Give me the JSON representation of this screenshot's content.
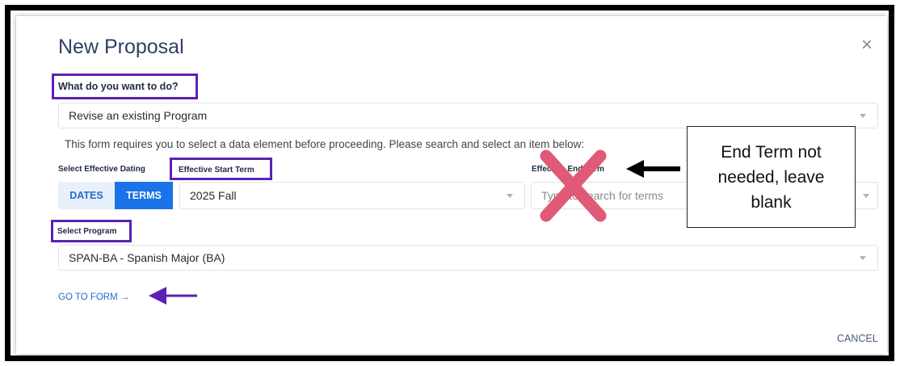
{
  "dialog": {
    "title": "New Proposal",
    "close_glyph": "×"
  },
  "question": {
    "label": "What do you want to do?",
    "value": "Revise an existing Program"
  },
  "info_text": "This form requires you to select a data element before proceeding. Please search and select an item below:",
  "dating": {
    "label": "Select Effective Dating",
    "start_label": "Effective Start Term",
    "dates_button": "DATES",
    "terms_button": "TERMS",
    "start_value": "2025 Fall",
    "end_label": "Effective End Term",
    "end_placeholder": "Type to search for terms"
  },
  "program": {
    "label": "Select Program",
    "value": "SPAN-BA - Spanish Major (BA)"
  },
  "actions": {
    "goto_label": "GO TO FORM",
    "goto_arrow": "→",
    "cancel_label": "CANCEL"
  },
  "annotation": {
    "callout_line1": "End Term not",
    "callout_line2": "needed, leave",
    "callout_line3": "blank",
    "highlight_color": "#5b21b6",
    "x_mark_color": "#e05a78"
  },
  "icons": {
    "close": "close-icon",
    "caret": "chevron-down-icon",
    "arrow": "arrow-right-icon"
  }
}
